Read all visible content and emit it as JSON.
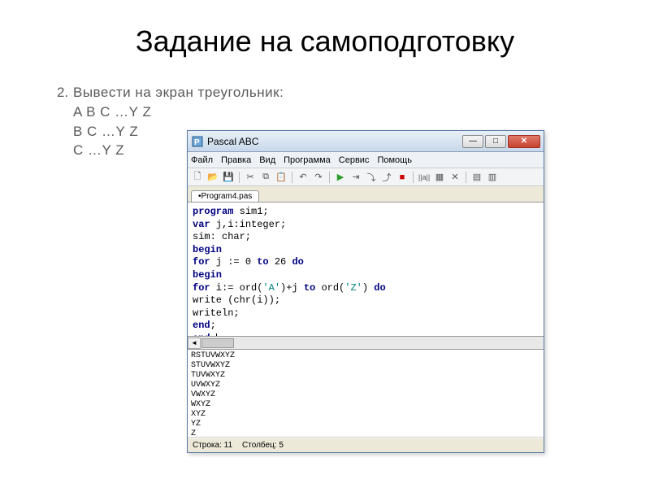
{
  "slide": {
    "title": "Задание на самоподготовку",
    "task_number": "2.",
    "task_line1": "Вывести на экран треугольник:",
    "task_line2": "A B C …Y Z",
    "task_line3": "B C …Y Z",
    "task_line4": "C …Y Z"
  },
  "ide": {
    "title": "Pascal ABC",
    "menu": {
      "file": "Файл",
      "edit": "Правка",
      "view": "Вид",
      "program": "Программа",
      "service": "Сервис",
      "help": "Помощь"
    },
    "tab": "•Program4.pas",
    "code": {
      "l1a": "program",
      "l1b": " sim1;",
      "l2a": "var",
      "l2b": " j,i:integer;",
      "l3": "sim: char;",
      "l4": "begin",
      "l5a": "for",
      "l5b": " j := 0 ",
      "l5c": "to",
      "l5d": " 26 ",
      "l5e": "do",
      "l6": "begin",
      "l7a": "for",
      "l7b": " i:= ord(",
      "l7c": "'A'",
      "l7d": ")+j ",
      "l7e": "to",
      "l7f": " ord(",
      "l7g": "'Z'",
      "l7h": ") ",
      "l7i": "do",
      "l8": "write (chr(i));",
      "l9": "writeln;",
      "l10": "end",
      "l10b": ";",
      "l11": "end",
      "l11b": "."
    },
    "output": {
      "o1": "RSTUVWXYZ",
      "o2": "STUVWXYZ",
      "o3": "TUVWXYZ",
      "o4": "UVWXYZ",
      "o5": "VWXYZ",
      "o6": "WXYZ",
      "o7": "XYZ",
      "o8": "YZ",
      "o9": "Z"
    },
    "status": {
      "row": "Строка: 11",
      "col": "Столбец: 5"
    }
  }
}
